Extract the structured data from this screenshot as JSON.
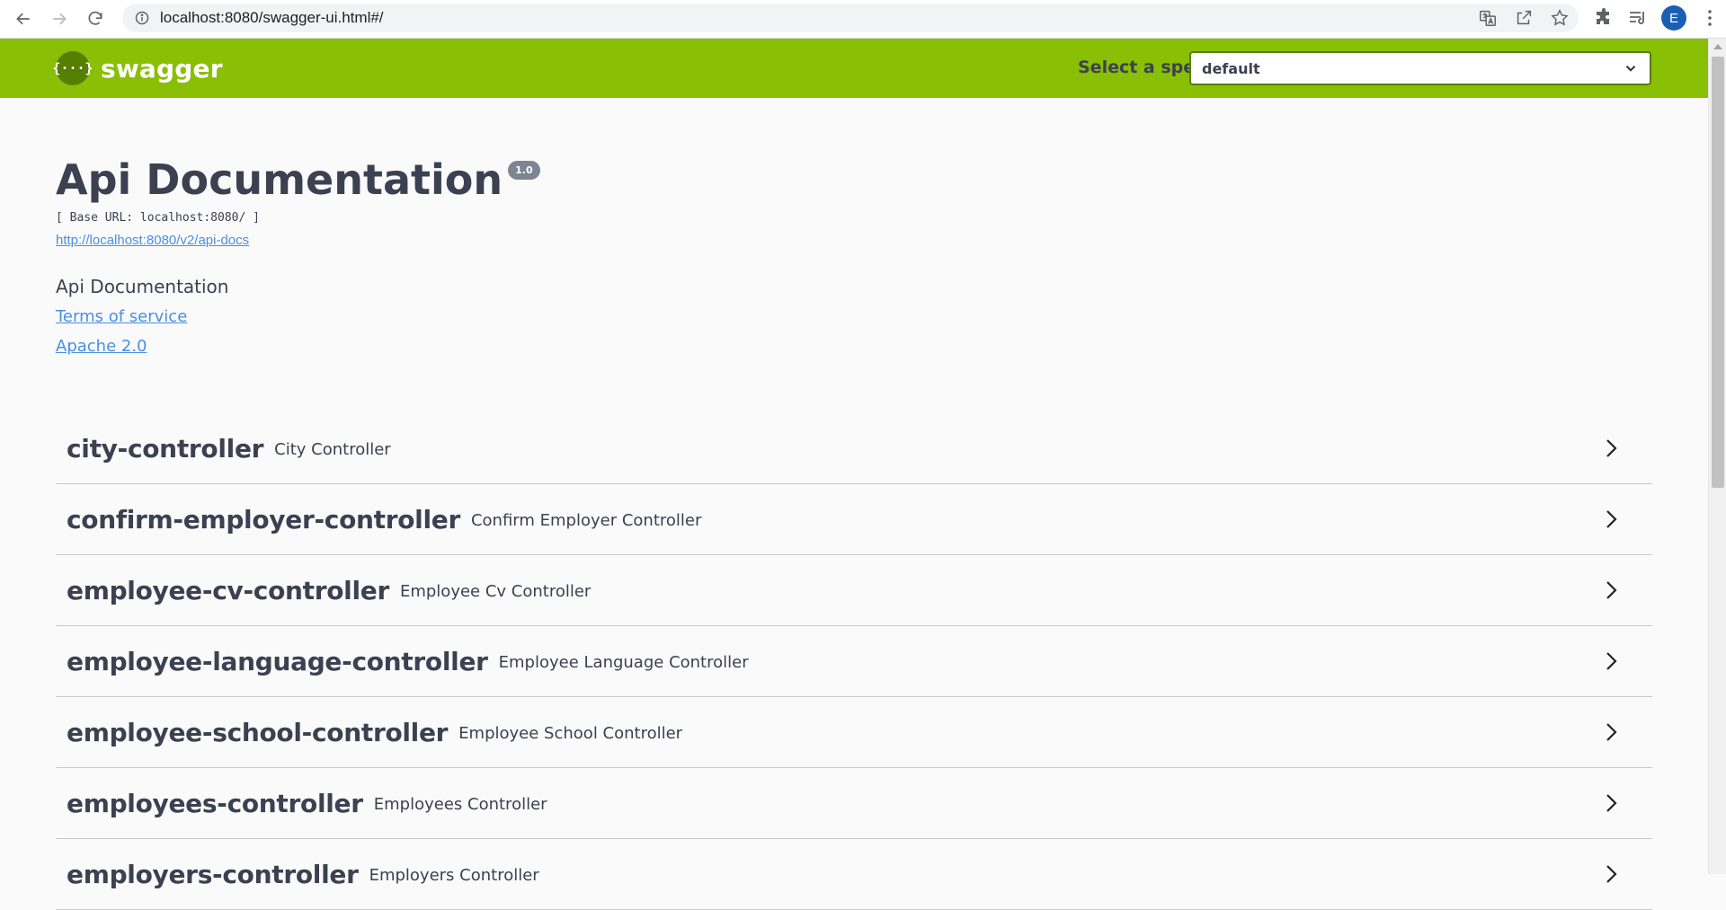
{
  "browser": {
    "url": "localhost:8080/swagger-ui.html#/",
    "avatar_letter": "E"
  },
  "topbar": {
    "logo_mark": "{···}",
    "logo_text": "swagger",
    "spec_label": "Select a spec",
    "spec_value": "default"
  },
  "info": {
    "title": "Api Documentation",
    "version": "1.0",
    "base_url": "[ Base URL: localhost:8080/ ]",
    "docs_link": "http://localhost:8080/v2/api-docs",
    "description": "Api Documentation",
    "terms": "Terms of service",
    "license": "Apache 2.0"
  },
  "controllers": [
    {
      "name": "city-controller",
      "desc": "City Controller"
    },
    {
      "name": "confirm-employer-controller",
      "desc": "Confirm Employer Controller"
    },
    {
      "name": "employee-cv-controller",
      "desc": "Employee Cv Controller"
    },
    {
      "name": "employee-language-controller",
      "desc": "Employee Language Controller"
    },
    {
      "name": "employee-school-controller",
      "desc": "Employee School Controller"
    },
    {
      "name": "employees-controller",
      "desc": "Employees Controller"
    },
    {
      "name": "employers-controller",
      "desc": "Employers Controller"
    }
  ],
  "colors": {
    "topbar": "#89bf04",
    "text": "#3b4151",
    "link": "#4990e2"
  }
}
